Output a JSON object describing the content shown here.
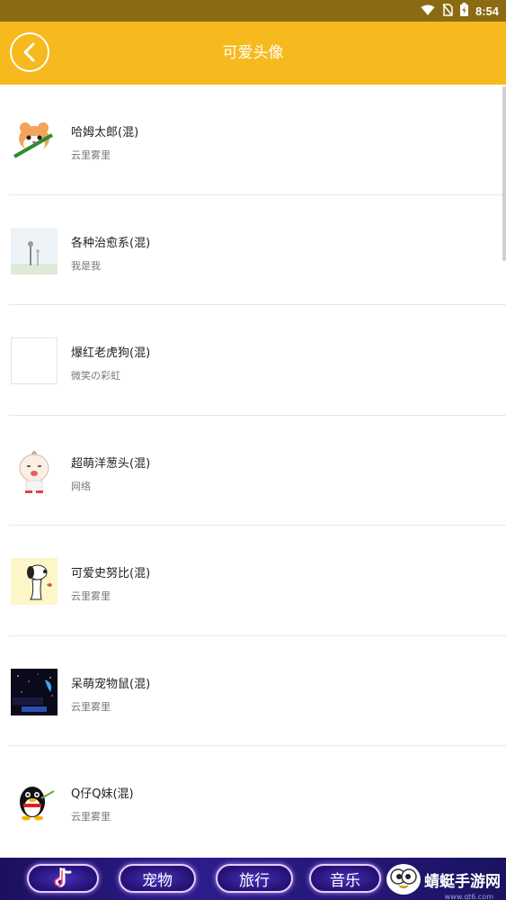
{
  "status": {
    "time": "8:54"
  },
  "header": {
    "title": "可爱头像"
  },
  "items": [
    {
      "title": "哈姆太郎(混)",
      "author": "云里雾里",
      "thumb_color": "#ffffff"
    },
    {
      "title": "各种治愈系(混)",
      "author": "我是我",
      "thumb_color": "#eef3f8"
    },
    {
      "title": "爆红老虎狗(混)",
      "author": "微笑の彩虹",
      "thumb_color": "#ffffff"
    },
    {
      "title": "超萌洋葱头(混)",
      "author": "网络",
      "thumb_color": "#ffffff"
    },
    {
      "title": "可爱史努比(混)",
      "author": "云里雾里",
      "thumb_color": "#fdf6c8"
    },
    {
      "title": "呆萌宠物鼠(混)",
      "author": "云里雾里",
      "thumb_color": "#0a0a1a"
    },
    {
      "title": "Q仔Q妹(混)",
      "author": "云里雾里",
      "thumb_color": "#ffffff"
    }
  ],
  "ad_banner": {
    "tags": [
      "宠物",
      "旅行",
      "音乐"
    ],
    "brand": "蜻蜓手游网",
    "url": "www.qt6.com"
  },
  "colors": {
    "header": "#f6b91e",
    "status_bar": "#8a6a12"
  }
}
